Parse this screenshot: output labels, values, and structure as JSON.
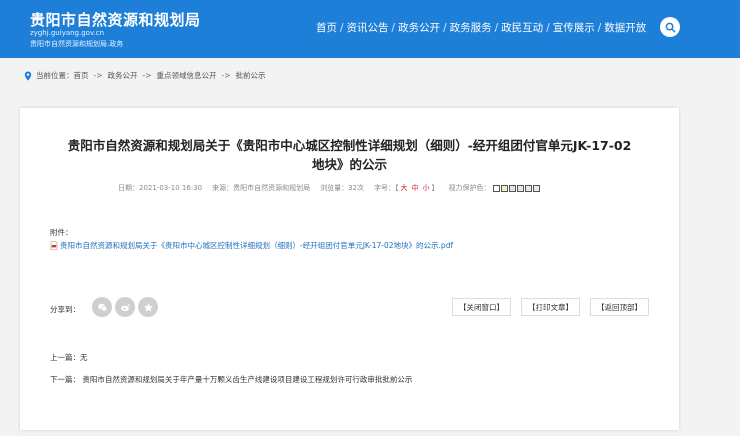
{
  "header": {
    "title": "贵阳市自然资源和规划局",
    "domain": "zyghj.guiyang.gov.cn",
    "subtitle": "贵阳市自然资源和规划局.政务",
    "nav": [
      "首页",
      "资讯公告",
      "政务公开",
      "政务服务",
      "政民互动",
      "宣传展示",
      "数据开放"
    ],
    "nav_separator": "/"
  },
  "breadcrumb": {
    "prefix": "当前位置：",
    "items": [
      "首页",
      "政务公开",
      "重点领域信息公开",
      "批前公示"
    ],
    "arrow": "->"
  },
  "article": {
    "title_line1": "贵阳市自然资源和规划局关于《贵阳市中心城区控制性详细规划（细则）-经开组团付官单元JK-17-02",
    "title_line2": "地块》的公示",
    "date": "日期：2021-03-10 16:30",
    "source": "来源：贵阳市自然资源和规划局",
    "views": "浏览量：32次",
    "fontsize_label": "字号：【",
    "font_large": "大",
    "font_medium": "中",
    "font_small": "小",
    "fontsize_end": "】",
    "eye_label": "视力保护色：",
    "eye_colors": [
      "#ffffff",
      "#f6e9c9",
      "#dde8d0",
      "#dfe7f2",
      "#f1dfe9",
      "#e9e9e9"
    ],
    "attach_label": "附件：",
    "attach_file": "贵阳市自然资源和规划局关于《贵阳市中心城区控制性详细规划（细则）-经开组团付官单元JK-17-02地块》的公示.pdf",
    "share_label": "分享到：",
    "buttons": [
      "【关闭窗口】",
      "【打印文章】",
      "【返回顶部】"
    ],
    "prev": "上一篇：无",
    "next": "下一篇： 贵阳市自然资源和规划局关于年产量十万颗义齿生产线建设项目建设工程规划许可行政审批批前公示"
  }
}
